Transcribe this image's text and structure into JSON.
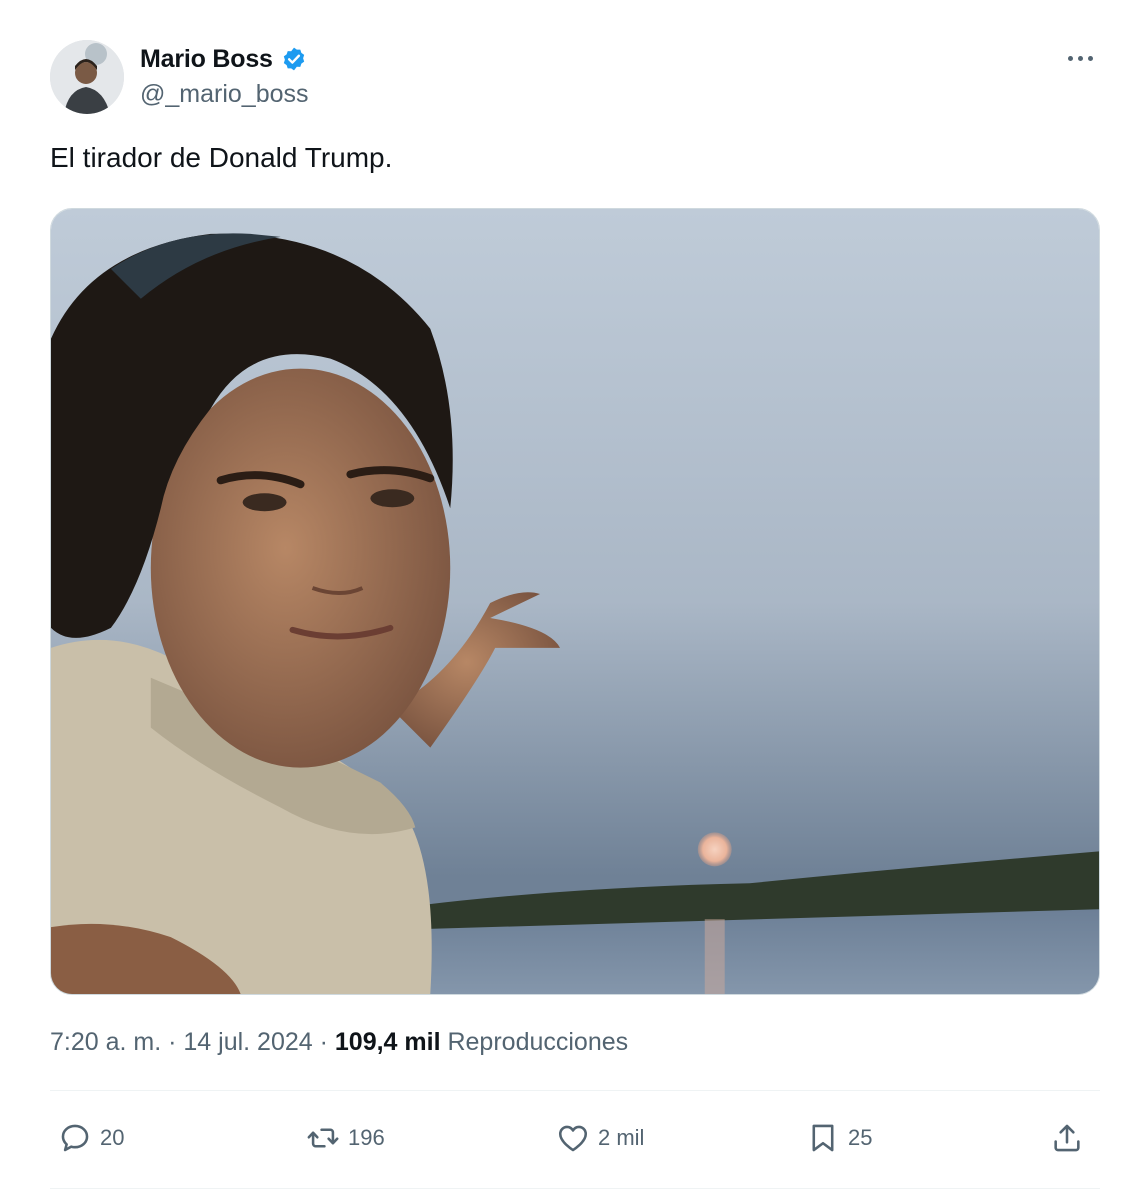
{
  "author": {
    "display_name": "Mario Boss",
    "handle": "@_mario_boss",
    "verified": true
  },
  "tweet": {
    "text": "El tirador de Donald Trump."
  },
  "meta": {
    "time": "7:20 a. m.",
    "sep1": " · ",
    "date": "14 jul. 2024",
    "sep2": " · ",
    "views_count": "109,4 mil",
    "views_label": " Reproducciones"
  },
  "actions": {
    "replies": "20",
    "retweets": "196",
    "likes": "2 mil",
    "bookmarks": "25"
  },
  "icons": [
    "verified-badge-icon",
    "more-icon",
    "reply-icon",
    "retweet-icon",
    "like-icon",
    "bookmark-icon",
    "share-icon"
  ],
  "colors": {
    "text": "#0f1419",
    "secondary": "#536471",
    "verified": "#1d9bf0",
    "border": "#cfd9de"
  }
}
